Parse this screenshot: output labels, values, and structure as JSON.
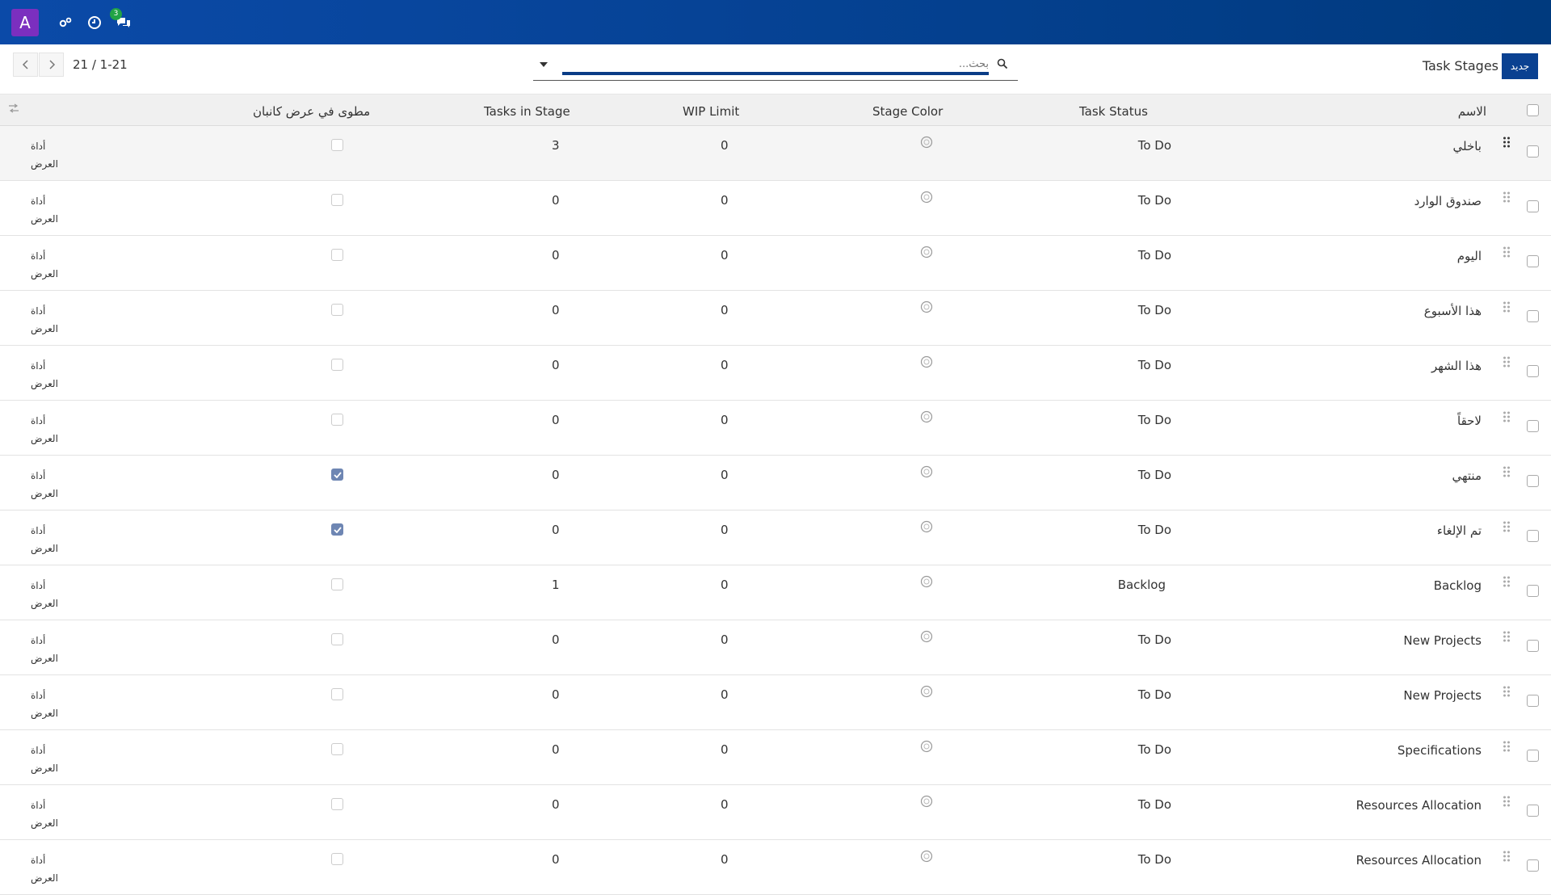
{
  "topbar": {
    "avatar_letter": "A",
    "messages_badge": "3"
  },
  "controls": {
    "pager": "21 / 1-21",
    "search_placeholder": "بحث...",
    "page_title": "Task Stages",
    "new_button": "جديد"
  },
  "columns": {
    "name": "الاسم",
    "task_status": "Task Status",
    "stage_color": "Stage Color",
    "wip_limit": "WIP Limit",
    "tasks_in_stage": "Tasks in Stage",
    "folded": "مطوى في عرض كانبان"
  },
  "rows": [
    {
      "name": "باخلي",
      "status": "To Do",
      "wip": "0",
      "tasks": "3",
      "folded": false,
      "action1": "أداة",
      "action2": "العرض"
    },
    {
      "name": "صندوق الوارد",
      "status": "To Do",
      "wip": "0",
      "tasks": "0",
      "folded": false,
      "action1": "أداة",
      "action2": "العرض"
    },
    {
      "name": "اليوم",
      "status": "To Do",
      "wip": "0",
      "tasks": "0",
      "folded": false,
      "action1": "أداة",
      "action2": "العرض"
    },
    {
      "name": "هذا الأسبوع",
      "status": "To Do",
      "wip": "0",
      "tasks": "0",
      "folded": false,
      "action1": "أداة",
      "action2": "العرض"
    },
    {
      "name": "هذا الشهر",
      "status": "To Do",
      "wip": "0",
      "tasks": "0",
      "folded": false,
      "action1": "أداة",
      "action2": "العرض"
    },
    {
      "name": "لاحقاً",
      "status": "To Do",
      "wip": "0",
      "tasks": "0",
      "folded": false,
      "action1": "أداة",
      "action2": "العرض"
    },
    {
      "name": "منتهي",
      "status": "To Do",
      "wip": "0",
      "tasks": "0",
      "folded": true,
      "action1": "أداة",
      "action2": "العرض"
    },
    {
      "name": "تم الإلغاء",
      "status": "To Do",
      "wip": "0",
      "tasks": "0",
      "folded": true,
      "action1": "أداة",
      "action2": "العرض"
    },
    {
      "name": "Backlog",
      "status": "Backlog",
      "wip": "0",
      "tasks": "1",
      "folded": false,
      "action1": "أداة",
      "action2": "العرض"
    },
    {
      "name": "New Projects",
      "status": "To Do",
      "wip": "0",
      "tasks": "0",
      "folded": false,
      "action1": "أداة",
      "action2": "العرض"
    },
    {
      "name": "New Projects",
      "status": "To Do",
      "wip": "0",
      "tasks": "0",
      "folded": false,
      "action1": "أداة",
      "action2": "العرض"
    },
    {
      "name": "Specifications",
      "status": "To Do",
      "wip": "0",
      "tasks": "0",
      "folded": false,
      "action1": "أداة",
      "action2": "العرض"
    },
    {
      "name": "Resources Allocation",
      "status": "To Do",
      "wip": "0",
      "tasks": "0",
      "folded": false,
      "action1": "أداة",
      "action2": "العرض"
    },
    {
      "name": "Resources Allocation",
      "status": "To Do",
      "wip": "0",
      "tasks": "0",
      "folded": false,
      "action1": "أداة",
      "action2": "العرض"
    }
  ]
}
